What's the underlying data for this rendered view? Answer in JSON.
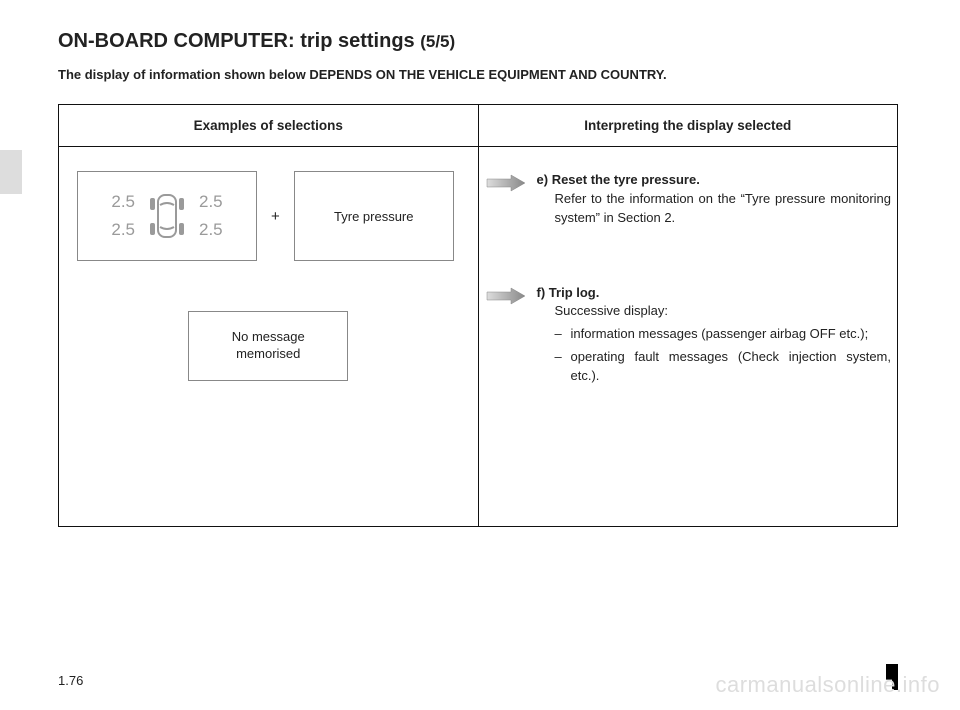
{
  "title_main": "ON-BOARD COMPUTER: trip settings ",
  "title_sub": "(5/5)",
  "depends_note": "The display of information shown below DEPENDS ON THE VEHICLE EQUIPMENT AND COUNTRY.",
  "headers": {
    "left": "Examples of selections",
    "right": "Interpreting the display selected"
  },
  "left": {
    "tyre_values": {
      "fl": "2.5",
      "rl": "2.5",
      "fr": "2.5",
      "rr": "2.5"
    },
    "plus": "+",
    "tyre_label": "Tyre pressure",
    "nomsg_line1": "No message",
    "nomsg_line2": "memorised"
  },
  "right": {
    "item_e": {
      "letter": "e)",
      "label": "Reset the tyre pressure.",
      "body": "Refer to the information on the “Tyre pressure monitoring system” in Section 2."
    },
    "item_f": {
      "letter": "f)",
      "label": "Trip log.",
      "sub": "Successive display:",
      "bullets": [
        "information messages (passenger airbag OFF etc.);",
        "operating fault messages (Check injection system, etc.)."
      ]
    }
  },
  "page_number": "1.76",
  "watermark": "carmanualsonline.info"
}
